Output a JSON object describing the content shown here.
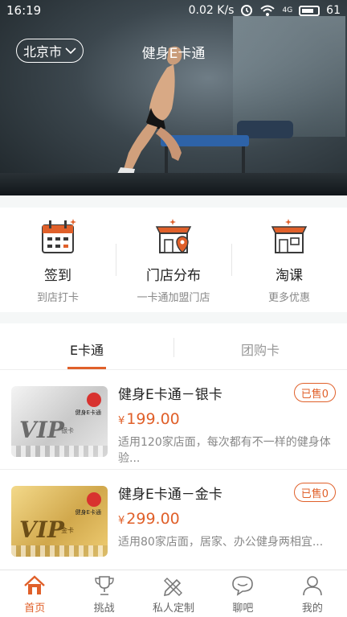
{
  "status_bar": {
    "time": "16:19",
    "speed": "0.02 K/s",
    "network": "4G",
    "battery": "61"
  },
  "header": {
    "city": "北京市",
    "title": "健身E卡通"
  },
  "quick_actions": [
    {
      "title": "签到",
      "subtitle": "到店打卡",
      "icon": "calendar-icon"
    },
    {
      "title": "门店分布",
      "subtitle": "一卡通加盟门店",
      "icon": "store-location-icon"
    },
    {
      "title": "淘课",
      "subtitle": "更多优惠",
      "icon": "store-icon"
    }
  ],
  "tabs": [
    {
      "label": "E卡通"
    },
    {
      "label": "团购卡"
    }
  ],
  "products": [
    {
      "name": "健身E卡通－银卡",
      "currency": "¥",
      "price": "199.00",
      "sold": "已售0",
      "desc": "适用120家店面，每次都有不一样的健身体验...",
      "card": {
        "brand": "健身E卡通",
        "vip": "VIP",
        "tier": "银卡"
      }
    },
    {
      "name": "健身E卡通－金卡",
      "currency": "¥",
      "price": "299.00",
      "sold": "已售0",
      "desc": "适用80家店面，居家、办公健身两相宜...",
      "card": {
        "brand": "健身E卡通",
        "vip": "VIP",
        "tier": "金卡"
      }
    }
  ],
  "bottom_nav": [
    {
      "label": "首页",
      "icon": "home-icon"
    },
    {
      "label": "挑战",
      "icon": "trophy-icon"
    },
    {
      "label": "私人定制",
      "icon": "pencil-ruler-icon"
    },
    {
      "label": "聊吧",
      "icon": "chat-icon"
    },
    {
      "label": "我的",
      "icon": "user-icon"
    }
  ],
  "colors": {
    "accent": "#e0602a",
    "background": "#f5f7f7"
  }
}
